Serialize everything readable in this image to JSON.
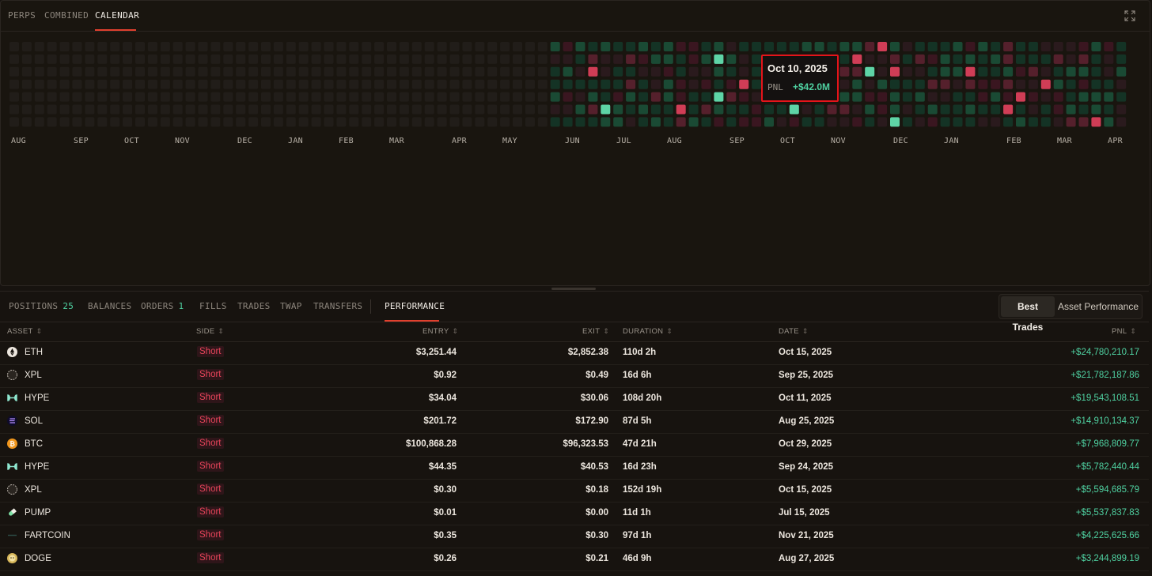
{
  "top_tabs": [
    {
      "label": "PERPS",
      "active": false
    },
    {
      "label": "COMBINED",
      "active": false
    },
    {
      "label": "CALENDAR",
      "active": true
    }
  ],
  "calendar": {
    "months": [
      "AUG",
      "SEP",
      "OCT",
      "NOV",
      "DEC",
      "JAN",
      "FEB",
      "MAR",
      "APR",
      "MAY",
      "JUN",
      "JUL",
      "AUG",
      "SEP",
      "OCT",
      "NOV",
      "DEC",
      "JAN",
      "FEB",
      "MAR",
      "APR"
    ],
    "colors": {
      "empty": "#211d19",
      "neutral": "#2a1a1d",
      "green_dim": "#143325",
      "green_mid": "#1a4a34",
      "green_bright": "#5ed4a6",
      "red_dim": "#3a1620",
      "red_mid": "#55202c",
      "red_bright": "#d03d56"
    },
    "tooltip": {
      "date": "Oct 10, 2025",
      "label": "PNL",
      "value": "+$42.0M"
    }
  },
  "bottom_tabs": [
    {
      "label": "POSITIONS",
      "count": "25"
    },
    {
      "label": "BALANCES",
      "count": ""
    },
    {
      "label": "ORDERS",
      "count": "1"
    },
    {
      "label": "FILLS",
      "count": ""
    },
    {
      "label": "TRADES",
      "count": ""
    },
    {
      "label": "TWAP",
      "count": ""
    },
    {
      "label": "TRANSFERS",
      "count": ""
    },
    {
      "label": "PERFORMANCE",
      "count": "",
      "active": true
    }
  ],
  "toggle": {
    "best_trades": "Best Trades",
    "asset_performance": "Asset Performance"
  },
  "table": {
    "headers": {
      "asset": "ASSET",
      "side": "SIDE",
      "entry": "ENTRY",
      "exit": "EXIT",
      "duration": "DURATION",
      "date": "DATE",
      "pnl": "PNL"
    },
    "rows": [
      {
        "asset": "ETH",
        "icon": "eth-icon",
        "side": "Short",
        "entry": "$3,251.44",
        "exit": "$2,852.38",
        "duration": "110d 2h",
        "date": "Oct 15, 2025",
        "pnl": "+$24,780,210.17"
      },
      {
        "asset": "XPL",
        "icon": "xpl-icon",
        "side": "Short",
        "entry": "$0.92",
        "exit": "$0.49",
        "duration": "16d 6h",
        "date": "Sep 25, 2025",
        "pnl": "+$21,782,187.86"
      },
      {
        "asset": "HYPE",
        "icon": "hype-icon",
        "side": "Short",
        "entry": "$34.04",
        "exit": "$30.06",
        "duration": "108d 20h",
        "date": "Oct 11, 2025",
        "pnl": "+$19,543,108.51"
      },
      {
        "asset": "SOL",
        "icon": "sol-icon",
        "side": "Short",
        "entry": "$201.72",
        "exit": "$172.90",
        "duration": "87d 5h",
        "date": "Aug 25, 2025",
        "pnl": "+$14,910,134.37"
      },
      {
        "asset": "BTC",
        "icon": "btc-icon",
        "side": "Short",
        "entry": "$100,868.28",
        "exit": "$96,323.53",
        "duration": "47d 21h",
        "date": "Oct 29, 2025",
        "pnl": "+$7,968,809.77"
      },
      {
        "asset": "HYPE",
        "icon": "hype-icon",
        "side": "Short",
        "entry": "$44.35",
        "exit": "$40.53",
        "duration": "16d 23h",
        "date": "Sep 24, 2025",
        "pnl": "+$5,782,440.44"
      },
      {
        "asset": "XPL",
        "icon": "xpl-icon",
        "side": "Short",
        "entry": "$0.30",
        "exit": "$0.18",
        "duration": "152d 19h",
        "date": "Oct 15, 2025",
        "pnl": "+$5,594,685.79"
      },
      {
        "asset": "PUMP",
        "icon": "pump-icon",
        "side": "Short",
        "entry": "$0.01",
        "exit": "$0.00",
        "duration": "11d 1h",
        "date": "Jul 15, 2025",
        "pnl": "+$5,537,837.83"
      },
      {
        "asset": "FARTCOIN",
        "icon": "fartcoin-icon",
        "side": "Short",
        "entry": "$0.35",
        "exit": "$0.30",
        "duration": "97d 1h",
        "date": "Nov 21, 2025",
        "pnl": "+$4,225,625.66"
      },
      {
        "asset": "DOGE",
        "icon": "doge-icon",
        "side": "Short",
        "entry": "$0.26",
        "exit": "$0.21",
        "duration": "46d 9h",
        "date": "Aug 27, 2025",
        "pnl": "+$3,244,899.19"
      }
    ]
  }
}
